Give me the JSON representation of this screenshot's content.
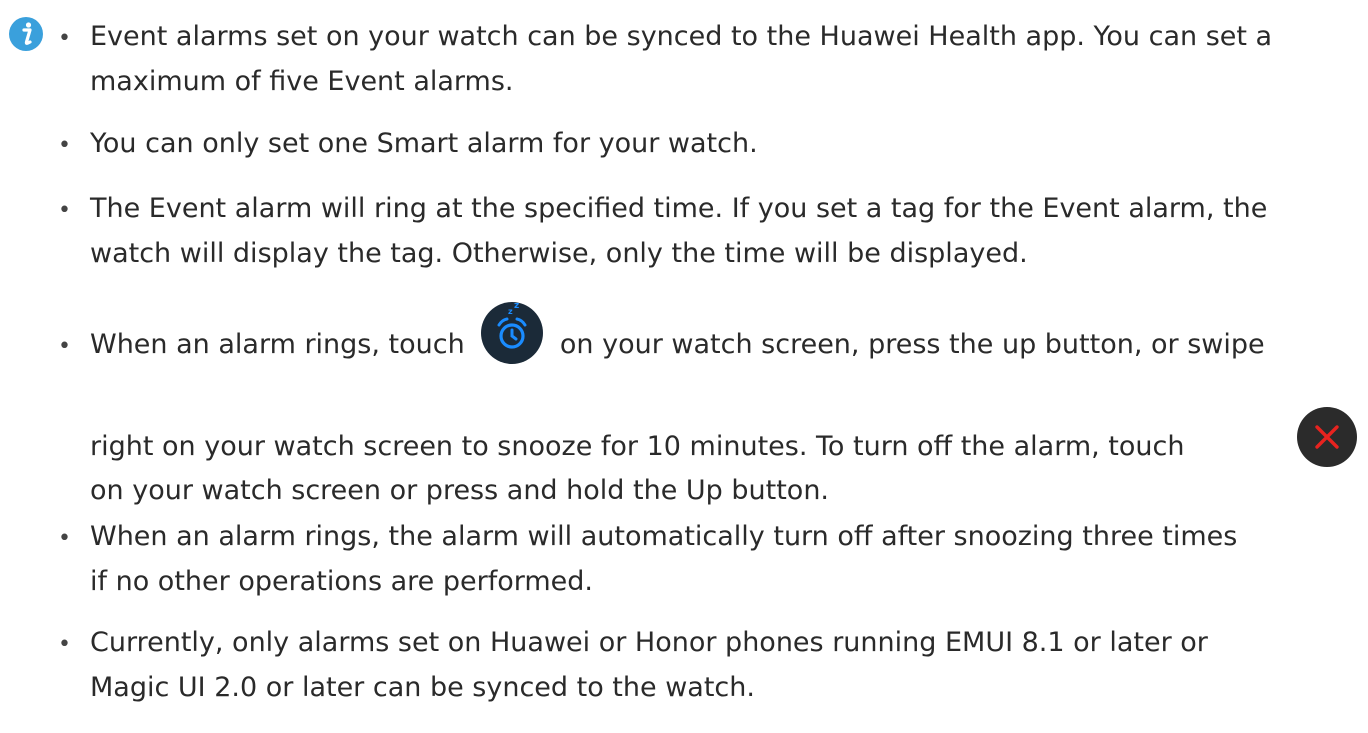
{
  "icons": {
    "note": "info-icon",
    "snooze": "snooze-alarm-icon",
    "dismiss": "close-icon",
    "note_color": "#3aa0dc",
    "snooze_color": "#1a8cff",
    "dismiss_color": "#e8231f"
  },
  "notes": [
    {
      "line1": "Event alarms set on your watch can be synced to the Huawei Health app. You can set a",
      "line2": "maximum of five Event alarms."
    },
    {
      "line1": "You can only set one Smart alarm for your watch."
    },
    {
      "line1": "The Event alarm will ring at the specified time. If you set a tag for the Event alarm, the",
      "line2": "watch will display the tag. Otherwise, only the time will be displayed."
    },
    {
      "line1_before": "When an alarm rings, touch",
      "line1_after": "on your watch screen, press the up button, or swipe",
      "line2": "right on your watch screen to snooze for 10 minutes. To turn off the alarm, touch",
      "line3": "on your watch screen or press and hold the Up button."
    },
    {
      "line1": "When an alarm rings, the alarm will automatically turn off after snoozing three times",
      "line2": "if no other operations are performed."
    },
    {
      "line1": "Currently, only alarms set on Huawei or Honor phones running EMUI 8.1 or later or",
      "line2": "Magic UI 2.0 or later can be synced to the watch."
    }
  ]
}
